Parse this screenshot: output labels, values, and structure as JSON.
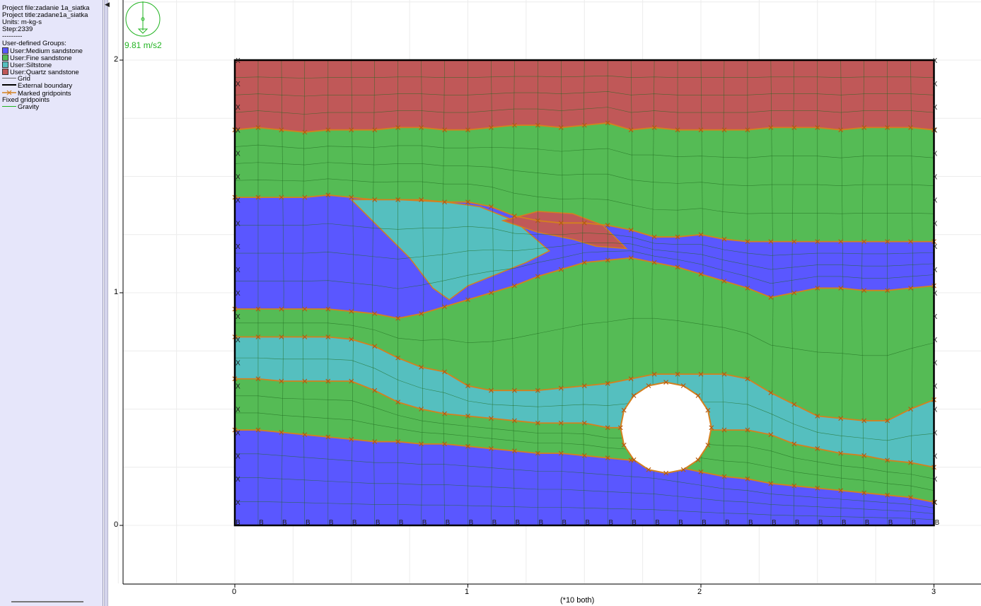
{
  "info": {
    "project_file": "Project file:zadanie 1a_siatka",
    "project_title": "Project title:zadane1a_siatka",
    "units": "Units: m-kg-s",
    "step": "Step:2339",
    "separator": "---------",
    "groups_heading": "User-defined Groups:"
  },
  "legend": {
    "groups": [
      {
        "label": "User:Medium sandstone",
        "color": "#5a57ff"
      },
      {
        "label": "User:Fine sandstone",
        "color": "#55bb55"
      },
      {
        "label": "User:Siltstone",
        "color": "#55bfbf"
      },
      {
        "label": "User:Quartz sandstone",
        "color": "#c05858"
      }
    ],
    "grid": "Grid",
    "external_boundary": "External boundary",
    "marked_gridpoints": "Marked gridpoints",
    "fixed_gridpoints": "Fixed gridpoints",
    "gravity": "Gravity"
  },
  "gravity": {
    "value": "9.81 m/s2"
  },
  "axes": {
    "x_ticks": [
      "0",
      "1",
      "2",
      "3"
    ],
    "y_ticks": [
      "0",
      "1",
      "2"
    ],
    "scale_note": "(*10 both)"
  },
  "model": {
    "width": 3,
    "height": 2,
    "upper_interfaces": [
      {
        "name": "quartz-fine",
        "y": [
          1.7,
          1.71,
          1.7,
          1.69,
          1.7,
          1.7,
          1.7,
          1.71,
          1.71,
          1.7,
          1.7,
          1.71,
          1.72,
          1.72,
          1.71,
          1.72,
          1.73,
          1.7,
          1.71,
          1.7,
          1.7,
          1.7,
          1.7,
          1.71,
          1.71,
          1.71,
          1.7,
          1.71,
          1.71,
          1.71,
          1.7
        ]
      },
      {
        "name": "fine-medium-top",
        "y": [
          1.41,
          1.41,
          1.41,
          1.41,
          1.42,
          1.41,
          1.4,
          1.4,
          1.4,
          1.39,
          1.39,
          1.37,
          1.33,
          1.31,
          1.3,
          1.3,
          1.29,
          1.27,
          1.24,
          1.24,
          1.25,
          1.23,
          1.22,
          1.22,
          1.22,
          1.22,
          1.22,
          1.22,
          1.22,
          1.22,
          1.22
        ]
      },
      {
        "name": "medium-fine",
        "y": [
          0.93,
          0.93,
          0.93,
          0.93,
          0.93,
          0.92,
          0.91,
          0.89,
          0.91,
          0.94,
          0.97,
          1.0,
          1.03,
          1.07,
          1.1,
          1.13,
          1.14,
          1.15,
          1.13,
          1.11,
          1.08,
          1.05,
          1.02,
          0.98,
          1.0,
          1.02,
          1.02,
          1.01,
          1.01,
          1.02,
          1.03
        ]
      },
      {
        "name": "fine-silt",
        "y": [
          0.81,
          0.81,
          0.81,
          0.81,
          0.81,
          0.8,
          0.77,
          0.72,
          0.68,
          0.66,
          0.6,
          0.58,
          0.58,
          0.58,
          0.59,
          0.6,
          0.61,
          0.63,
          0.65,
          0.65,
          0.65,
          0.65,
          0.63,
          0.57,
          0.52,
          0.47,
          0.46,
          0.45,
          0.45,
          0.5,
          0.54
        ]
      },
      {
        "name": "silt-fine",
        "y": [
          0.63,
          0.63,
          0.62,
          0.62,
          0.62,
          0.62,
          0.58,
          0.53,
          0.5,
          0.48,
          0.47,
          0.46,
          0.45,
          0.44,
          0.44,
          0.44,
          0.42,
          0.42,
          0.41,
          0.4,
          0.41,
          0.41,
          0.41,
          0.39,
          0.35,
          0.33,
          0.31,
          0.3,
          0.28,
          0.27,
          0.25
        ]
      },
      {
        "name": "fine-medium-bottom",
        "y": [
          0.41,
          0.41,
          0.4,
          0.39,
          0.38,
          0.37,
          0.36,
          0.36,
          0.35,
          0.35,
          0.34,
          0.33,
          0.32,
          0.31,
          0.31,
          0.3,
          0.29,
          0.28,
          0.27,
          0.25,
          0.23,
          0.21,
          0.2,
          0.18,
          0.17,
          0.16,
          0.15,
          0.14,
          0.13,
          0.12,
          0.1
        ]
      }
    ],
    "siltstone_lens": [
      [
        0.5,
        1.4
      ],
      [
        0.7,
        1.4
      ],
      [
        0.9,
        1.39
      ],
      [
        1.05,
        1.37
      ],
      [
        1.2,
        1.31
      ],
      [
        1.35,
        1.18
      ],
      [
        1.25,
        1.13
      ],
      [
        1.1,
        1.07
      ],
      [
        1.0,
        1.03
      ],
      [
        0.92,
        0.97
      ],
      [
        0.85,
        1.02
      ],
      [
        0.75,
        1.15
      ],
      [
        0.6,
        1.3
      ]
    ],
    "quartz_lens": [
      [
        1.15,
        1.31
      ],
      [
        1.3,
        1.35
      ],
      [
        1.45,
        1.34
      ],
      [
        1.58,
        1.29
      ],
      [
        1.68,
        1.19
      ],
      [
        1.55,
        1.2
      ],
      [
        1.45,
        1.23
      ],
      [
        1.3,
        1.26
      ]
    ],
    "hole": {
      "cx": 1.85,
      "cy": 0.42,
      "r": 0.195
    }
  }
}
